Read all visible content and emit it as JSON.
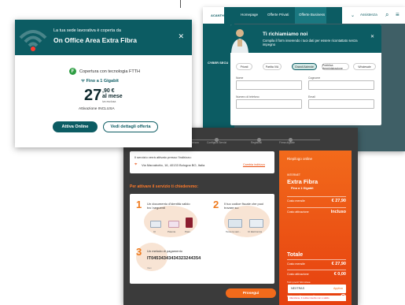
{
  "card1": {
    "header_subtitle": "La tua sede lavorativa è coperta da",
    "header_title": "On Office Area Extra Fibra",
    "close_glyph": "✕",
    "tech_badge": "F",
    "tech_text": "Copertura con tecnologia FTTH",
    "speed_text": "Fino a 1 Gigabit",
    "price_int": "27",
    "price_dec": ",90 €",
    "price_period": "al mese",
    "price_note": "iva esclusa",
    "activation_text": "Attivazione INCLUSA",
    "btn_primary": "Attiva Online",
    "btn_secondary": "Vedi dettagli offerta",
    "accent_color": "#0c5c63"
  },
  "card2": {
    "logo": "ACANTHO",
    "nav": [
      "Homepage",
      "Offerte Privati",
      "Offerte Business",
      "Assistenza"
    ],
    "bg_text": "CYBER SECU",
    "modal_title": "Ti richiamiamo noi",
    "modal_subtitle": "Compila il form inserendo i tuoi dati per essere ricontattato senza impegno",
    "close_glyph": "✕",
    "pills": [
      "Privati",
      "Partita IVA",
      "Grandi Aziende",
      "Pubblica Amministrazione",
      "Wholesale"
    ],
    "selected_pill": "Grandi Aziende",
    "fields": [
      "Nome",
      "Cognome",
      "Numero di telefono",
      "Email"
    ]
  },
  "card3": {
    "steps": [
      "Verifica Indirizzo",
      "Configura Servizi",
      "Registrati",
      "Firma digitale"
    ],
    "address_title": "Il servizio verrà attivato presso l'indirizzo:",
    "address": "Via Marzabotto, 16, 40133 Bologna BO, Italia",
    "address_edit": "Cambia indirizzo",
    "section_title": "Per attivare il servizio ti chiederemo:",
    "doc1_num": "1",
    "doc1_text": "Un documento d'identità valido tra i seguenti",
    "doc1_caps": [
      "CI",
      "Patente",
      "Pass."
    ],
    "doc2_num": "2",
    "doc2_text": "Il tuo codice fiscale che puoi trovare su:",
    "doc2_caps": [
      "Tessera sani...",
      "CI Elettronica"
    ],
    "doc3_num": "3",
    "doc3_text": "Un metodo di pagamento",
    "iban": "IT04534343434323244354",
    "iban_label": "Iban",
    "btn_next": "Prosegui",
    "summary_title": "Riepilogo online",
    "summary_sub": "INTERNET",
    "summary_name": "Extra Fibra",
    "summary_speed": "Fino a 1 Gigabit",
    "rows": [
      {
        "k": "Costo mensile",
        "v": "€ 27,90"
      },
      {
        "k": "Costo attivazione",
        "v": "Incluso"
      }
    ],
    "total_title": "Totale",
    "total_rows": [
      {
        "k": "Costo mensile",
        "v": "€ 27,90"
      },
      {
        "k": "Costo attivazione",
        "v": "€ 0,00"
      }
    ],
    "total_note": "Tutti i prezzi IVA inclusa",
    "promo_text": "Hai un codice promo?",
    "promo_plus": "+",
    "promo_code": "NEXTRAS",
    "promo_apply": "Applica",
    "promo_error": "Attenzione, il codice inserito non è valido"
  }
}
